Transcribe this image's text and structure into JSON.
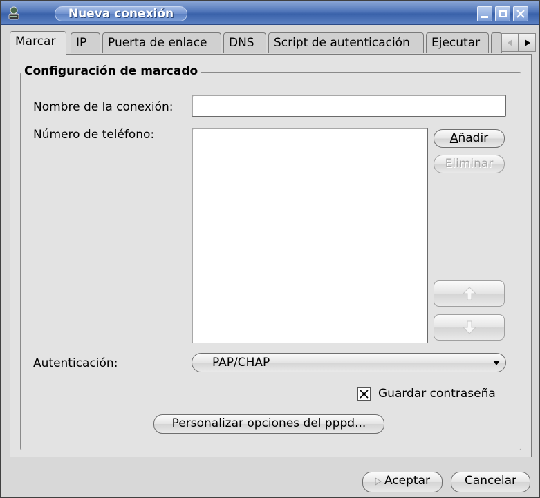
{
  "window": {
    "title": "Nueva conexión",
    "icons": {
      "app": "network-wizard-icon",
      "minimize": "minimize-icon",
      "maximize": "maximize-icon",
      "close": "close-icon"
    }
  },
  "tabs": [
    {
      "label": "Marcar",
      "active": true
    },
    {
      "label": "IP",
      "active": false
    },
    {
      "label": "Puerta de enlace",
      "active": false
    },
    {
      "label": "DNS",
      "active": false
    },
    {
      "label": "Script de autenticación",
      "active": false
    },
    {
      "label": "Ejecutar",
      "active": false
    },
    {
      "label": "",
      "active": false
    }
  ],
  "tab_scroll": {
    "left_icon": "arrow-left-icon",
    "right_icon": "arrow-right-icon"
  },
  "dial": {
    "group_title": "Configuración de marcado",
    "connection_name_label": "Nombre de la conexión:",
    "connection_name_value": "",
    "phone_number_label": "Número de teléfono:",
    "phone_numbers": [],
    "add_button": "Añadir",
    "add_button_accel_char": "A",
    "add_button_rest": "ñadir",
    "remove_button": "Eliminar",
    "auth_label": "Autenticación:",
    "auth_value": "PAP/CHAP",
    "save_password_label": "Guardar contraseña",
    "save_password_checked": true,
    "pppd_button": "Personalizar opciones del pppd..."
  },
  "footer": {
    "accept_button": "Aceptar",
    "cancel_button": "Cancelar"
  }
}
